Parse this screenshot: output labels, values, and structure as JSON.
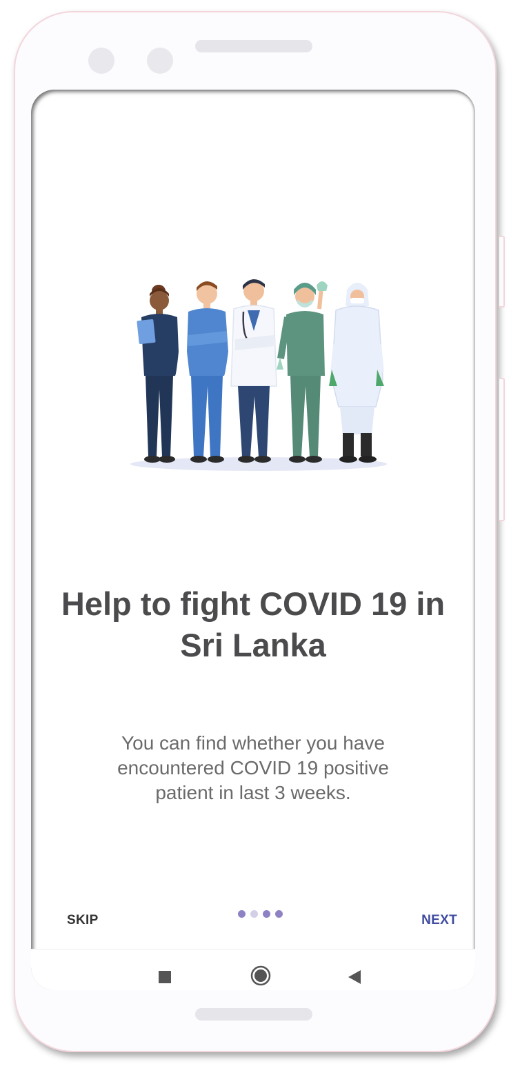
{
  "onboarding": {
    "title_line1": "Help to fight COVID 19 in",
    "title_line2": "Sri Lanka",
    "description_line1": "You can find whether you have",
    "description_line2": "encountered COVID 19 positive",
    "description_line3": "patient in last 3 weeks.",
    "skip_label": "SKIP",
    "next_label": "NEXT",
    "page_indicator": {
      "total": 4,
      "current": 2
    }
  },
  "illustration": {
    "icon": "healthcare-workers-illustration"
  },
  "nav_bar": {
    "recents_icon": "square-icon",
    "home_icon": "circle-home-icon",
    "back_icon": "triangle-back-icon"
  },
  "colors": {
    "title": "#4b4b4d",
    "description": "#6a6a6a",
    "skip": "#333333",
    "next": "#3e4ba0",
    "dot": "#8f82c4",
    "dot_active": "#d3cfe6"
  }
}
